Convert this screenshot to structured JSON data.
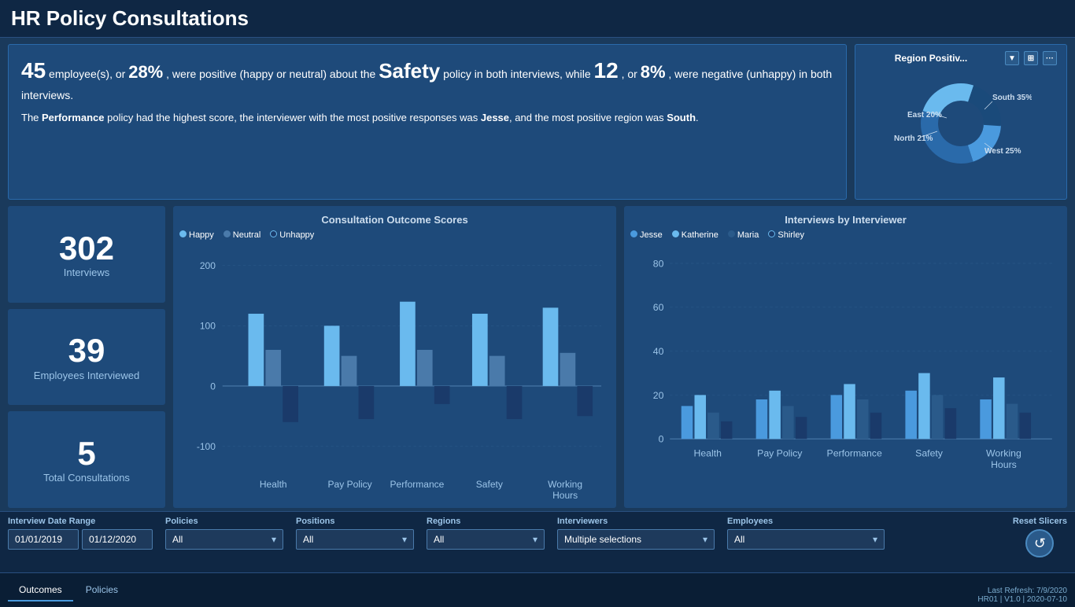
{
  "header": {
    "title": "HR Policy Consultations"
  },
  "summary": {
    "line1_pre": "45",
    "line1_pct1": "28%",
    "line1_text1": " employee(s), or ",
    "line1_text2": ", were positive (happy or neutral) about the ",
    "line1_policy": "Safety",
    "line1_text3": " policy in both interviews, while ",
    "line1_num2": "12",
    "line1_text4": ", or ",
    "line1_pct2": "8%",
    "line1_text5": ", were negative (unhappy) in both interviews.",
    "line2_pre": "The ",
    "line2_policy": "Performance",
    "line2_text1": " policy had the highest score, the interviewer with the most positive responses was ",
    "line2_interviewer": "Jesse",
    "line2_text2": ", and the most positive region was ",
    "line2_region": "South",
    "line2_end": "."
  },
  "donut": {
    "title": "Region Positiv...",
    "segments": [
      {
        "label": "East 20%",
        "value": 20,
        "color": "#4a9ade"
      },
      {
        "label": "South 35%",
        "value": 35,
        "color": "#2a6aaa"
      },
      {
        "label": "West 25%",
        "value": 25,
        "color": "#1a4a7a"
      },
      {
        "label": "North 21%",
        "value": 21,
        "color": "#6abaee"
      }
    ]
  },
  "stats": [
    {
      "num": "302",
      "label": "Interviews"
    },
    {
      "num": "39",
      "label": "Employees Interviewed"
    },
    {
      "num": "5",
      "label": "Total Consultations"
    }
  ],
  "chart1": {
    "title": "Consultation Outcome Scores",
    "legend": [
      {
        "label": "Happy",
        "color": "#6abaee"
      },
      {
        "label": "Neutral",
        "color": "#4a7aaa"
      },
      {
        "label": "Unhappy",
        "color": "#1a3a6a"
      }
    ],
    "y_labels": [
      "200",
      "100",
      "0",
      "-100"
    ],
    "categories": [
      "Health",
      "Pay Policy",
      "Performance",
      "Safety",
      "Working Hours"
    ],
    "data": {
      "happy": [
        120,
        100,
        140,
        120,
        130
      ],
      "neutral": [
        60,
        50,
        60,
        50,
        55
      ],
      "unhappy": [
        -60,
        -55,
        -30,
        -55,
        -50
      ]
    }
  },
  "chart2": {
    "title": "Interviews by Interviewer",
    "legend": [
      {
        "label": "Jesse",
        "color": "#4a9ade"
      },
      {
        "label": "Katherine",
        "color": "#6abaee"
      },
      {
        "label": "Maria",
        "color": "#2a5a8a"
      },
      {
        "label": "Shirley",
        "color": "#1a3a6a"
      }
    ],
    "y_labels": [
      "80",
      "60",
      "40",
      "20",
      "0"
    ],
    "categories": [
      "Health",
      "Pay Policy",
      "Performance",
      "Safety",
      "Working Hours"
    ],
    "data": {
      "jesse": [
        15,
        18,
        20,
        22,
        18
      ],
      "katherine": [
        20,
        22,
        25,
        30,
        28
      ],
      "maria": [
        12,
        15,
        18,
        20,
        16
      ],
      "shirley": [
        8,
        10,
        12,
        14,
        12
      ]
    }
  },
  "filters": {
    "date_range_label": "Interview Date Range",
    "date_start": "01/01/2019",
    "date_end": "01/12/2020",
    "policies_label": "Policies",
    "policies_value": "All",
    "positions_label": "Positions",
    "positions_value": "All",
    "regions_label": "Regions",
    "regions_value": "All",
    "interviewers_label": "Interviewers",
    "interviewers_value": "Multiple selections",
    "employees_label": "Employees",
    "employees_value": "All",
    "reset_label": "Reset Slicers"
  },
  "nav_tabs": [
    {
      "label": "Outcomes",
      "active": true
    },
    {
      "label": "Policies",
      "active": false
    }
  ],
  "footer": {
    "refresh": "Last Refresh: 7/9/2020",
    "version": "HR01 | V1.0 | 2020-07-10"
  }
}
